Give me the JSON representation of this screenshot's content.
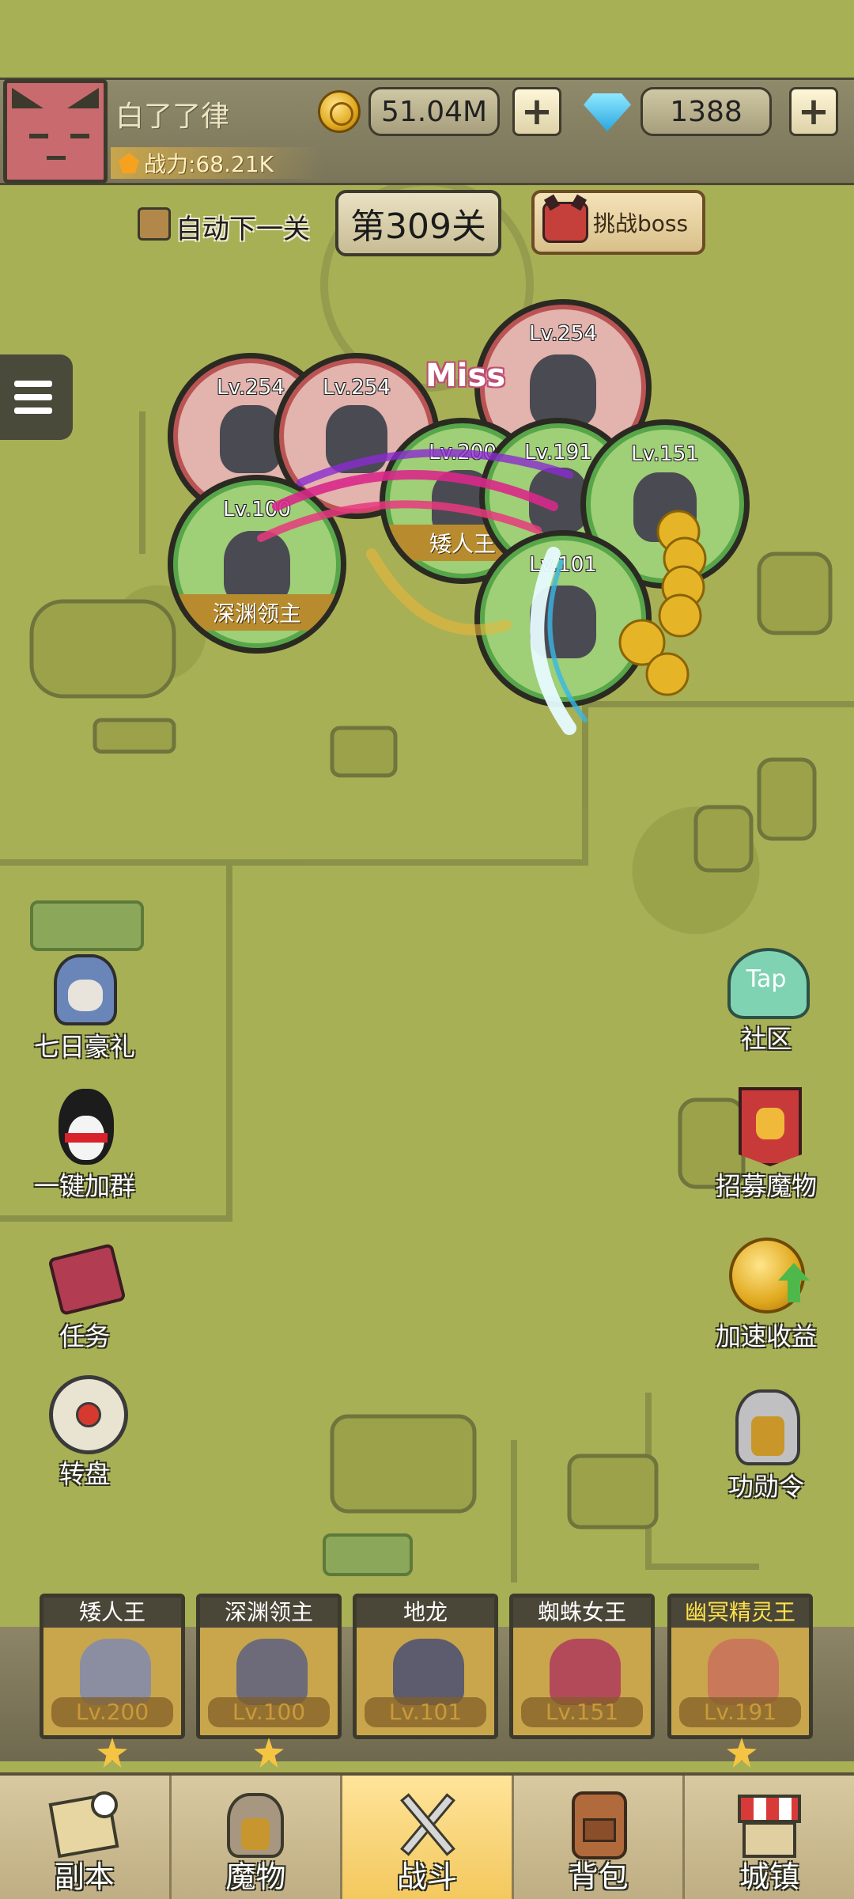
{
  "player": {
    "name": "白了了律",
    "power": "战力:68.21K"
  },
  "currency": {
    "gold": "51.04M",
    "gems": "1388",
    "plus": "+"
  },
  "stage": {
    "auto_next_label": "自动下一关",
    "current": "第309关",
    "boss_button": "挑战boss"
  },
  "battle": {
    "miss_text": "Miss",
    "enemies": [
      {
        "level": "Lv.254"
      },
      {
        "level": "Lv.254"
      },
      {
        "level": "Lv.254"
      }
    ],
    "allies": [
      {
        "level": "Lv.100",
        "name": "深渊领主"
      },
      {
        "level": "Lv.200",
        "name": "矮人王"
      },
      {
        "level": "Lv.191",
        "name": ""
      },
      {
        "level": "Lv.151",
        "name": ""
      },
      {
        "level": "Lv.101",
        "name": ""
      }
    ]
  },
  "left_features": [
    {
      "label": "七日豪礼",
      "icon": "helmet-knight-icon"
    },
    {
      "label": "一键加群",
      "icon": "penguin-icon"
    },
    {
      "label": "任务",
      "icon": "quest-book-icon"
    },
    {
      "label": "转盘",
      "icon": "wheel-icon"
    }
  ],
  "right_features": [
    {
      "label": "社区",
      "icon": "tap-community-icon"
    },
    {
      "label": "招募魔物",
      "icon": "recruit-banner-icon"
    },
    {
      "label": "加速收益",
      "icon": "speed-coin-icon"
    },
    {
      "label": "功勋令",
      "icon": "merit-helmet-icon"
    }
  ],
  "tap_text": "Tap",
  "heroes": [
    {
      "name": "矮人王",
      "level": "Lv.200",
      "star": true
    },
    {
      "name": "深渊领主",
      "level": "Lv.100",
      "star": true
    },
    {
      "name": "地龙",
      "level": "Lv.101",
      "star": false
    },
    {
      "name": "蜘蛛女王",
      "level": "Lv.151",
      "star": false
    },
    {
      "name": "幽冥精灵王",
      "level": "Lv.191",
      "star": true
    }
  ],
  "nav": [
    {
      "label": "副本",
      "icon": "map-icon"
    },
    {
      "label": "魔物",
      "icon": "monster-helmet-icon"
    },
    {
      "label": "战斗",
      "icon": "crossed-swords-icon",
      "active": true
    },
    {
      "label": "背包",
      "icon": "backpack-icon"
    },
    {
      "label": "城镇",
      "icon": "town-shop-icon"
    }
  ],
  "colors": {
    "map_green": "#a8b055",
    "enemy_red": "#ba5454",
    "ally_green": "#58a64a",
    "gold": "#c9a64c",
    "active_tab": "#f3c85e"
  }
}
